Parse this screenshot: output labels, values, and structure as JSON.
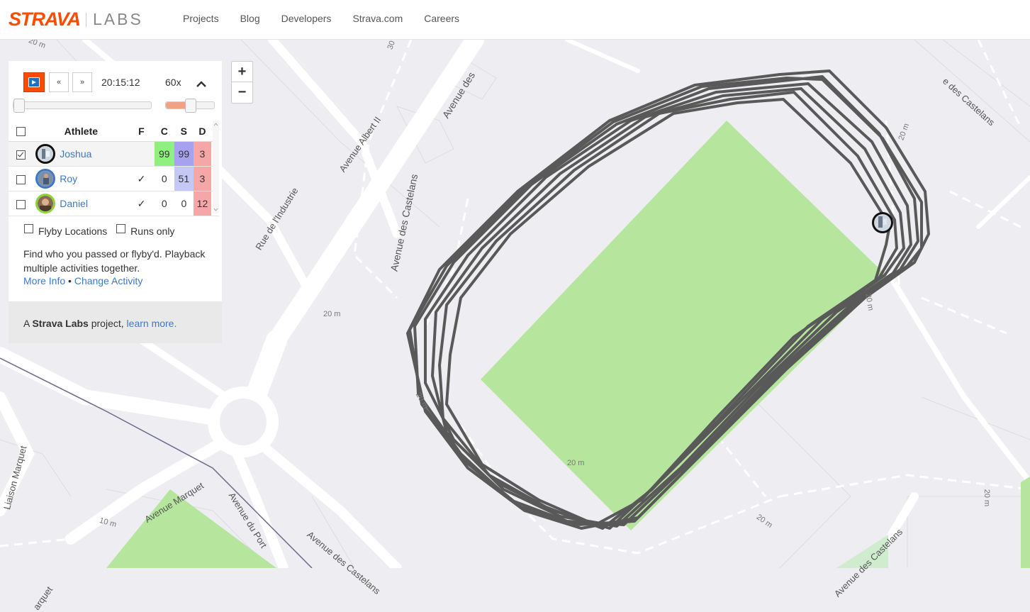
{
  "header": {
    "logo_main": "STRAVA",
    "logo_sub": "LABS",
    "nav": [
      "Projects",
      "Blog",
      "Developers",
      "Strava.com",
      "Careers"
    ]
  },
  "playback": {
    "time": "20:15:12",
    "speed": "60x",
    "rewind_icon": "«",
    "forward_icon": "»",
    "progress_fraction": 0.0,
    "speed_fraction": 0.5
  },
  "table": {
    "headers": {
      "athlete": "Athlete",
      "f": "F",
      "c": "C",
      "s": "S",
      "d": "D"
    },
    "rows": [
      {
        "name": "Joshua",
        "checked": true,
        "f": "",
        "c": "99",
        "s": "99",
        "d": "3",
        "ring": "#111111"
      },
      {
        "name": "Roy",
        "checked": false,
        "f": "✓",
        "c": "0",
        "s": "51",
        "d": "3",
        "ring": "#3b79c5"
      },
      {
        "name": "Daniel",
        "checked": false,
        "f": "✓",
        "c": "0",
        "s": "0",
        "d": "12",
        "ring": "#8bd43a"
      }
    ]
  },
  "options": {
    "flyby": "Flyby Locations",
    "runs_only": "Runs only"
  },
  "description": "Find who you passed or flyby'd. Playback multiple activities together.",
  "links": {
    "more_info": "More Info",
    "separator": "•",
    "change_activity": "Change Activity"
  },
  "footer": {
    "prefix": "A ",
    "bold": "Strava Labs",
    "mid": " project, ",
    "link": "learn more."
  },
  "zoom": {
    "plus": "+",
    "minus": "−"
  },
  "map": {
    "streets": {
      "albert": "Avenue Albert II",
      "castelans_top": "Avenue des",
      "castelans_1": "Avenue des Castelans",
      "castelans_2": "Avenue des Castelans",
      "castelans_3": "Avenue des Castelans",
      "castelans_tr": "e des Castelans",
      "industrie": "Rue de l'Industrie",
      "marquet": "Avenue Marquet",
      "port": "Avenue du Port",
      "liaison": "Liaison Marquet",
      "marquet_b": "arquet"
    },
    "contours": [
      "20 m",
      "20 m",
      "20 m",
      "20 m",
      "20 m",
      "10 m",
      "20 m",
      "20 m",
      "20 m",
      "30 m"
    ]
  },
  "colors": {
    "brand": "#fc4c02",
    "track": "#555555",
    "field": "#b6e69d",
    "link": "#3b79c5"
  }
}
